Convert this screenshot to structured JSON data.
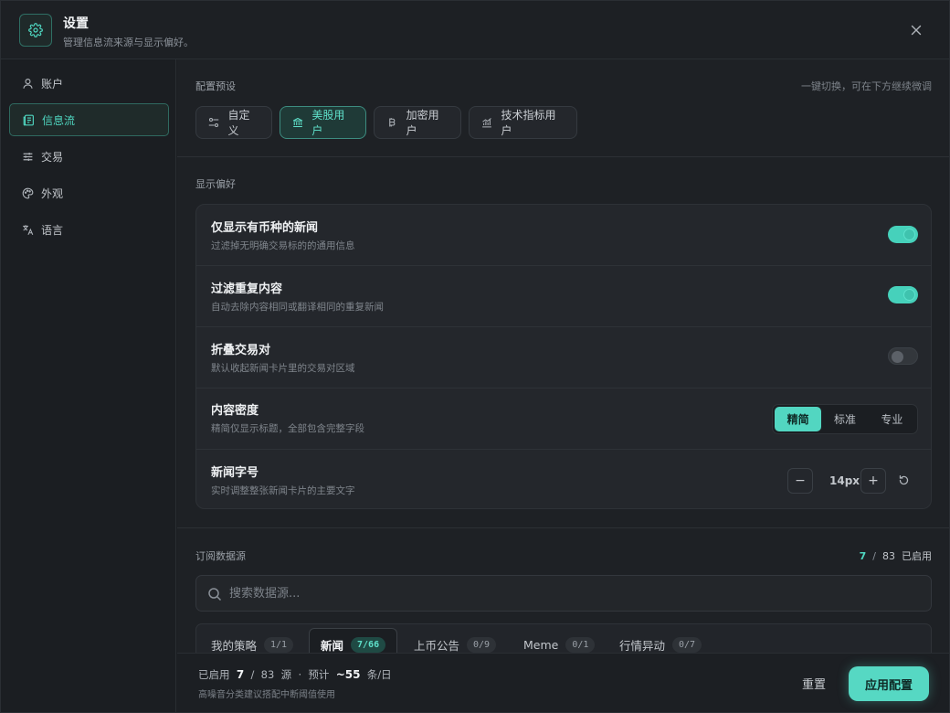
{
  "header": {
    "title": "设置",
    "subtitle": "管理信息流来源与显示偏好。"
  },
  "sidebar": {
    "items": [
      {
        "label": "账户",
        "icon": "user-icon"
      },
      {
        "label": "信息流",
        "icon": "newspaper-icon",
        "active": true
      },
      {
        "label": "交易",
        "icon": "sliders-icon"
      },
      {
        "label": "外观",
        "icon": "palette-icon"
      },
      {
        "label": "语言",
        "icon": "translate-icon"
      }
    ]
  },
  "presets": {
    "label": "配置预设",
    "hint": "一键切换，可在下方继续微调",
    "items": [
      {
        "label": "自定义",
        "icon": "sliders-icon"
      },
      {
        "label": "美股用户",
        "icon": "bank-icon",
        "active": true
      },
      {
        "label": "加密用户",
        "icon": "bitcoin-icon"
      },
      {
        "label": "技术指标用户",
        "icon": "chart-icon"
      }
    ]
  },
  "display": {
    "label": "显示偏好",
    "rows": [
      {
        "title": "仅显示有币种的新闻",
        "desc": "过滤掉无明确交易标的的通用信息",
        "on": true
      },
      {
        "title": "过滤重复内容",
        "desc": "自动去除内容相同或翻译相同的重复新闻",
        "on": true
      },
      {
        "title": "折叠交易对",
        "desc": "默认收起新闻卡片里的交易对区域",
        "on": false
      },
      {
        "title": "内容密度",
        "desc": "精简仅显示标题，全部包含完整字段"
      },
      {
        "title": "新闻字号",
        "desc": "实时调整整张新闻卡片的主要文字"
      }
    ],
    "density_options": [
      "精简",
      "标准",
      "专业"
    ],
    "density_selected": "精简",
    "font_size": "14px",
    "minus": "−",
    "plus": "+"
  },
  "subscriptions": {
    "label": "订阅数据源",
    "enabled": "7",
    "separator": "/",
    "total": "83",
    "enabled_suffix": "已启用",
    "search_placeholder": "搜索数据源...",
    "tabs": [
      {
        "label": "我的策略",
        "count": "1/1"
      },
      {
        "label": "新闻",
        "count": "7/66",
        "active": true
      },
      {
        "label": "上币公告",
        "count": "0/9"
      },
      {
        "label": "Meme",
        "count": "0/1"
      },
      {
        "label": "行情异动",
        "count": "0/7"
      }
    ]
  },
  "footer": {
    "prefix": "已启用",
    "enabled": "7",
    "slash": "/",
    "total": "83",
    "unit": "源",
    "dot": "·",
    "estimate_label": "预计",
    "estimate": "~55",
    "per_day": "条/日",
    "note": "高噪音分类建议搭配中断阈值使用",
    "reset_label": "重置",
    "apply_label": "应用配置"
  },
  "colors": {
    "accent": "#52d6c1",
    "background": "#1b1e22",
    "card": "#24272c"
  }
}
